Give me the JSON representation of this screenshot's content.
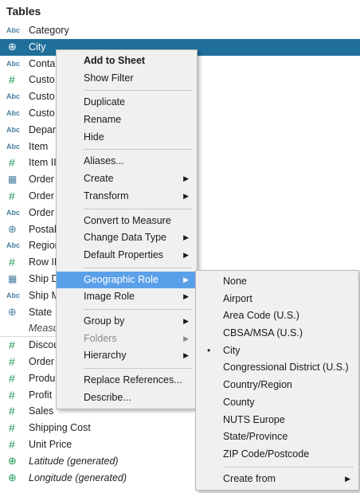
{
  "panel": {
    "title": "Tables"
  },
  "fields": [
    {
      "icon": "Abc",
      "type": "abc",
      "label": "Category"
    },
    {
      "icon": "⊕",
      "type": "globe",
      "label": "City",
      "selected": true
    },
    {
      "icon": "Abc",
      "type": "abc",
      "label": "Conta"
    },
    {
      "icon": "#",
      "type": "measure",
      "label": "Custo"
    },
    {
      "icon": "Abc",
      "type": "abc",
      "label": "Custo"
    },
    {
      "icon": "Abc",
      "type": "abc",
      "label": "Custo"
    },
    {
      "icon": "Abc",
      "type": "abc",
      "label": "Depar"
    },
    {
      "icon": "Abc",
      "type": "abc",
      "label": "Item"
    },
    {
      "icon": "#",
      "type": "measure",
      "label": "Item II"
    },
    {
      "icon": "▦",
      "type": "date",
      "label": "Order"
    },
    {
      "icon": "#",
      "type": "measure",
      "label": "Order"
    },
    {
      "icon": "Abc",
      "type": "abc",
      "label": "Order"
    },
    {
      "icon": "⊕",
      "type": "globe",
      "label": "Postal"
    },
    {
      "icon": "Abc",
      "type": "abc",
      "label": "Region"
    },
    {
      "icon": "#",
      "type": "measure",
      "label": "Row ID"
    },
    {
      "icon": "▦",
      "type": "date",
      "label": "Ship D"
    },
    {
      "icon": "Abc",
      "type": "abc",
      "label": "Ship M"
    },
    {
      "icon": "⊕",
      "type": "globe",
      "label": "State"
    },
    {
      "icon": "",
      "type": "header",
      "label": "Measu"
    },
    {
      "icon": "#",
      "type": "measure",
      "label": "Discou"
    },
    {
      "icon": "#",
      "type": "measure",
      "label": "Order"
    },
    {
      "icon": "#",
      "type": "measure",
      "label": "Produ"
    },
    {
      "icon": "#",
      "type": "measure",
      "label": "Profit"
    },
    {
      "icon": "#",
      "type": "measure",
      "label": "Sales"
    },
    {
      "icon": "#",
      "type": "measure",
      "label": "Shipping Cost"
    },
    {
      "icon": "#",
      "type": "measure",
      "label": "Unit Price"
    },
    {
      "icon": "⊕",
      "type": "measure-geo",
      "label": "Latitude (generated)",
      "italic": true
    },
    {
      "icon": "⊕",
      "type": "measure-geo",
      "label": "Longitude (generated)",
      "italic": true
    }
  ],
  "context_menu": {
    "groups": [
      [
        {
          "label": "Add to Sheet",
          "bold": true
        },
        {
          "label": "Show Filter"
        }
      ],
      [
        {
          "label": "Duplicate"
        },
        {
          "label": "Rename"
        },
        {
          "label": "Hide"
        }
      ],
      [
        {
          "label": "Aliases..."
        },
        {
          "label": "Create",
          "submenu": true
        },
        {
          "label": "Transform",
          "submenu": true
        }
      ],
      [
        {
          "label": "Convert to Measure"
        },
        {
          "label": "Change Data Type",
          "submenu": true
        },
        {
          "label": "Default Properties",
          "submenu": true
        }
      ],
      [
        {
          "label": "Geographic Role",
          "submenu": true,
          "highlight": true
        },
        {
          "label": "Image Role",
          "submenu": true
        }
      ],
      [
        {
          "label": "Group by",
          "submenu": true
        },
        {
          "label": "Folders",
          "submenu": true,
          "disabled": true
        },
        {
          "label": "Hierarchy",
          "submenu": true
        }
      ],
      [
        {
          "label": "Replace References..."
        },
        {
          "label": "Describe..."
        }
      ]
    ]
  },
  "geo_submenu": {
    "groups": [
      [
        {
          "label": "None"
        },
        {
          "label": "Airport"
        },
        {
          "label": "Area Code (U.S.)"
        },
        {
          "label": "CBSA/MSA (U.S.)"
        },
        {
          "label": "City",
          "checked": true
        },
        {
          "label": "Congressional District (U.S.)"
        },
        {
          "label": "Country/Region"
        },
        {
          "label": "County"
        },
        {
          "label": "NUTS Europe"
        },
        {
          "label": "State/Province"
        },
        {
          "label": "ZIP Code/Postcode"
        }
      ],
      [
        {
          "label": "Create from",
          "submenu": true
        }
      ]
    ]
  },
  "glyphs": {
    "arrow": "▶",
    "bullet": "•"
  }
}
